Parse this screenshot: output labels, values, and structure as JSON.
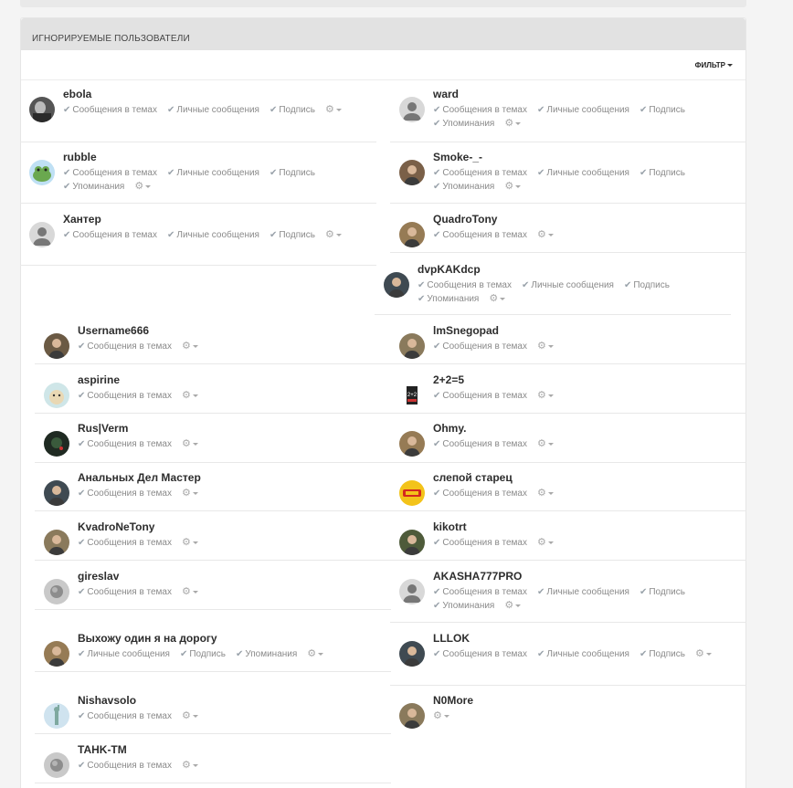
{
  "panel": {
    "title": "ИГНОРИРУЕМЫЕ ПОЛЬЗОВАТЕЛИ",
    "filter_label": "ФИЛЬТР"
  },
  "options": {
    "topics": "Сообщения в темах",
    "pm": "Личные сообщения",
    "sig": "Подпись",
    "mentions": "Упоминания"
  },
  "colors": {
    "accent": "#2d2d2d",
    "muted": "#8a8a8a",
    "header_bg": "#e2e2e2"
  },
  "users": [
    {
      "name": "ebola",
      "opts": [
        "topics",
        "pm",
        "sig"
      ],
      "avatar": "photo-bw"
    },
    {
      "name": "ward",
      "opts": [
        "topics",
        "pm",
        "sig",
        "mentions"
      ],
      "avatar": "default"
    },
    {
      "name": "rubble",
      "opts": [
        "topics",
        "pm",
        "sig",
        "mentions"
      ],
      "avatar": "frog"
    },
    {
      "name": "Smoke-_-",
      "opts": [
        "topics",
        "pm",
        "sig",
        "mentions"
      ],
      "avatar": "photo"
    },
    {
      "name": "Хантер",
      "opts": [
        "topics",
        "pm",
        "sig"
      ],
      "avatar": "default"
    },
    {
      "name": "QuadroTony",
      "opts": [
        "topics"
      ],
      "avatar": "photo"
    },
    {
      "name": "dvpKAKdcp",
      "opts": [
        "topics",
        "pm",
        "sig",
        "mentions"
      ],
      "avatar": "photo"
    },
    {
      "name": "Username666",
      "opts": [
        "topics"
      ],
      "avatar": "photo"
    },
    {
      "name": "lmSnegopad",
      "opts": [
        "topics"
      ],
      "avatar": "photo"
    },
    {
      "name": "aspirine",
      "opts": [
        "topics"
      ],
      "avatar": "pet"
    },
    {
      "name": "2+2=5",
      "opts": [
        "topics"
      ],
      "avatar": "poster"
    },
    {
      "name": "Rus|Verm",
      "opts": [
        "topics"
      ],
      "avatar": "dark"
    },
    {
      "name": "Ohmy.",
      "opts": [
        "topics"
      ],
      "avatar": "photo"
    },
    {
      "name": "Анальных Дел Мастер",
      "opts": [
        "topics"
      ],
      "avatar": "photo"
    },
    {
      "name": "слепой старец",
      "opts": [
        "topics"
      ],
      "avatar": "badge"
    },
    {
      "name": "KvadroNeTony",
      "opts": [
        "topics"
      ],
      "avatar": "photo"
    },
    {
      "name": "kikotrt",
      "opts": [
        "topics"
      ],
      "avatar": "photo"
    },
    {
      "name": "gireslav",
      "opts": [
        "topics"
      ],
      "avatar": "grey"
    },
    {
      "name": "AKASHA777PRO",
      "opts": [
        "topics",
        "pm",
        "sig",
        "mentions"
      ],
      "avatar": "default"
    },
    {
      "name": "Выхожу один я на дорогу",
      "opts": [
        "pm",
        "sig",
        "mentions"
      ],
      "avatar": "photo"
    },
    {
      "name": "LLLOK",
      "opts": [
        "topics",
        "pm",
        "sig"
      ],
      "avatar": "photo"
    },
    {
      "name": "Nishavsolo",
      "opts": [
        "topics"
      ],
      "avatar": "statue"
    },
    {
      "name": "N0More",
      "opts": [],
      "avatar": "photo"
    },
    {
      "name": "TAHK-TM",
      "opts": [
        "topics"
      ],
      "avatar": "grey"
    }
  ]
}
